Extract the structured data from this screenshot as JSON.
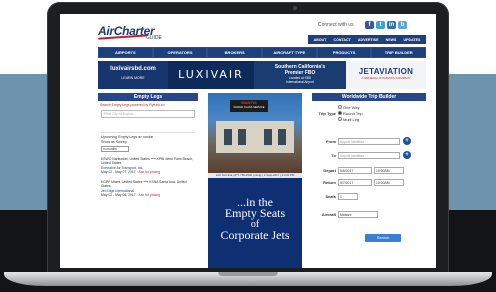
{
  "site": {
    "logo": "AirCharter",
    "logo_sub": "GUIDE",
    "connect_label": "Connect with us",
    "social": {
      "facebook": "f",
      "twitter": "t",
      "linkedin": "in",
      "other": "b"
    }
  },
  "util_nav": [
    "ABOUT",
    "CONTACT",
    "ADVERTISE",
    "NEWS",
    "UPDATES"
  ],
  "main_nav": [
    "AIRPORTS",
    "OPERATORS",
    "BROKERS",
    "AIRCRAFT TYPE",
    "PRODUCTS",
    "TRIP BUILDER"
  ],
  "banner": {
    "url": "luxivairsbd.com",
    "learn_more": "LEARN MORE",
    "brand": "LUXIVAIR",
    "fbo_title_1": "Southern California's",
    "fbo_title_2": "Premier FBO",
    "fbo_sub_1": "Located at SBD",
    "fbo_sub_2": "International Airport",
    "jet_name": "JETAVIATION",
    "jet_sub": "A GENERAL DYNAMICS COMPANY"
  },
  "empty_legs": {
    "title": "Empty Legs",
    "subtitle": "Search Empty Legs powered by Flyfunk.co",
    "search_placeholder": "Find City or Airport...",
    "upcoming": "Upcoming Empty Legs ac rundar",
    "show_as": "Show as Sweep",
    "select_value": "in months",
    "legs": [
      {
        "route": "KSWO Nantucket, United States ⟶ KPBI West Palm Beach, United States",
        "operator": "Executive Air Transport, Inc.",
        "date": "May 02 - May 07, 2017",
        "price": "Ask for pricing"
      },
      {
        "route": "KOPF Miami, United States ⟶ KSNA Santa Ana, United States",
        "operator": "Jet Edge International",
        "date": "May 02 - May 06, 2017",
        "price": "Ask for pricing"
      }
    ]
  },
  "ad": {
    "sign_title": "MANTIS",
    "sign_sub": "WORLD CLASS SERVICE",
    "caption": "LAX Terminal | 877-768-1500 | info@ | 1-Sept-2017 | 4:3:00 PM",
    "line1": "...in the",
    "line2": "Empty Seats",
    "line3": "of",
    "line4": "Corporate Jets"
  },
  "trip_builder": {
    "title": "Worldwide Trip Builder",
    "trip_type_label": "Trip Type",
    "trip_types": [
      "One Way",
      "Round Trip",
      "Multi Leg"
    ],
    "selected_trip_type": "Round Trip",
    "from_label": "From",
    "from_placeholder": "Airport Identifier",
    "to_label": "To",
    "to_placeholder": "Airport Identifier",
    "depart_label": "Depart",
    "depart_date": "5/6/2017",
    "depart_time": "10:00AM",
    "return_label": "Return",
    "return_date": "5/7/2017",
    "return_time": "10:00AM",
    "seats_label": "Seats",
    "seats_value": "1",
    "aircraft_label": "Aircraft",
    "aircraft_value": "Midsize",
    "search_label": "Search"
  }
}
